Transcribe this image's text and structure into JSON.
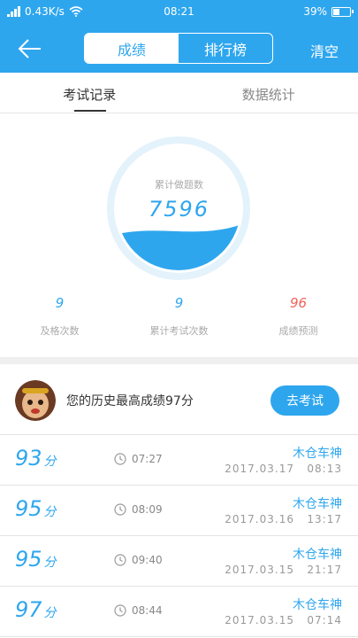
{
  "status_bar": {
    "network_speed": "0.43K/s",
    "time": "08:21",
    "battery": "39%",
    "battery_level": 0.39
  },
  "nav": {
    "segments": [
      "成绩",
      "排行榜"
    ],
    "active_segment": 0,
    "clear_label": "清空"
  },
  "tabs": {
    "items": [
      "考试记录",
      "数据统计"
    ],
    "active": 0
  },
  "gauge": {
    "label": "累计做题数",
    "value": "7596",
    "fill_fraction": 0.33,
    "colors": {
      "ring": "#e3f2fb",
      "fill": "#2ea6ee"
    }
  },
  "stats": [
    {
      "value": "9",
      "label": "及格次数"
    },
    {
      "value": "9",
      "label": "累计考试次数"
    },
    {
      "value": "96",
      "label": "成绩预测"
    }
  ],
  "best": {
    "text": "您的历史最高成绩97分",
    "button_label": "去考试"
  },
  "records": [
    {
      "score": "93",
      "unit": "分",
      "duration": "07:27",
      "title": "木仓车神",
      "date": "2017.03.17   08:13"
    },
    {
      "score": "95",
      "unit": "分",
      "duration": "08:09",
      "title": "木仓车神",
      "date": "2017.03.16   13:17"
    },
    {
      "score": "95",
      "unit": "分",
      "duration": "09:40",
      "title": "木仓车神",
      "date": "2017.03.15   21:17"
    },
    {
      "score": "97",
      "unit": "分",
      "duration": "08:44",
      "title": "木仓车神",
      "date": "2017.03.15   07:14"
    }
  ],
  "colors": {
    "accent": "#2ea6ee",
    "prediction": "#f0645a"
  }
}
